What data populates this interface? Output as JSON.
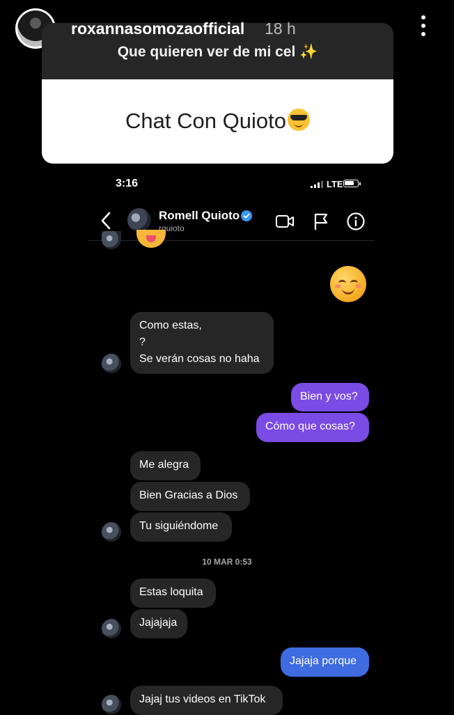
{
  "story": {
    "username": "roxannasomozaofficial",
    "time_ago": "18 h",
    "question": "Que quieren ver de mi cel ✨",
    "answer": "Chat Con Quioto"
  },
  "status_bar": {
    "time": "3:16",
    "network": "LTE"
  },
  "chat_header": {
    "name": "Romell Quioto",
    "handle": "rquioto",
    "icons": [
      "back-icon",
      "video-call-icon",
      "flag-icon",
      "info-icon"
    ]
  },
  "messages": {
    "m1": "Como estas,",
    "m2": "?",
    "m3": "Se verán cosas no haha",
    "m4": "Bien y vos?",
    "m5": "Cómo que cosas?",
    "m6": "Me alegra",
    "m7": "Bien Gracias a Dios",
    "m8": "Tu siguiéndome",
    "timestamp": "10 MAR 0:53",
    "m9": "Estas loquita",
    "m10": "Jajajaja",
    "m11": "Jajaja porque",
    "m12": "Jajaj tus videos en TikTok"
  },
  "colors": {
    "background": "#000000",
    "incoming_bubble": "#262626",
    "outgoing_purple": "#7b4be6",
    "outgoing_blue": "#3e6be0",
    "verified": "#3897f0"
  }
}
